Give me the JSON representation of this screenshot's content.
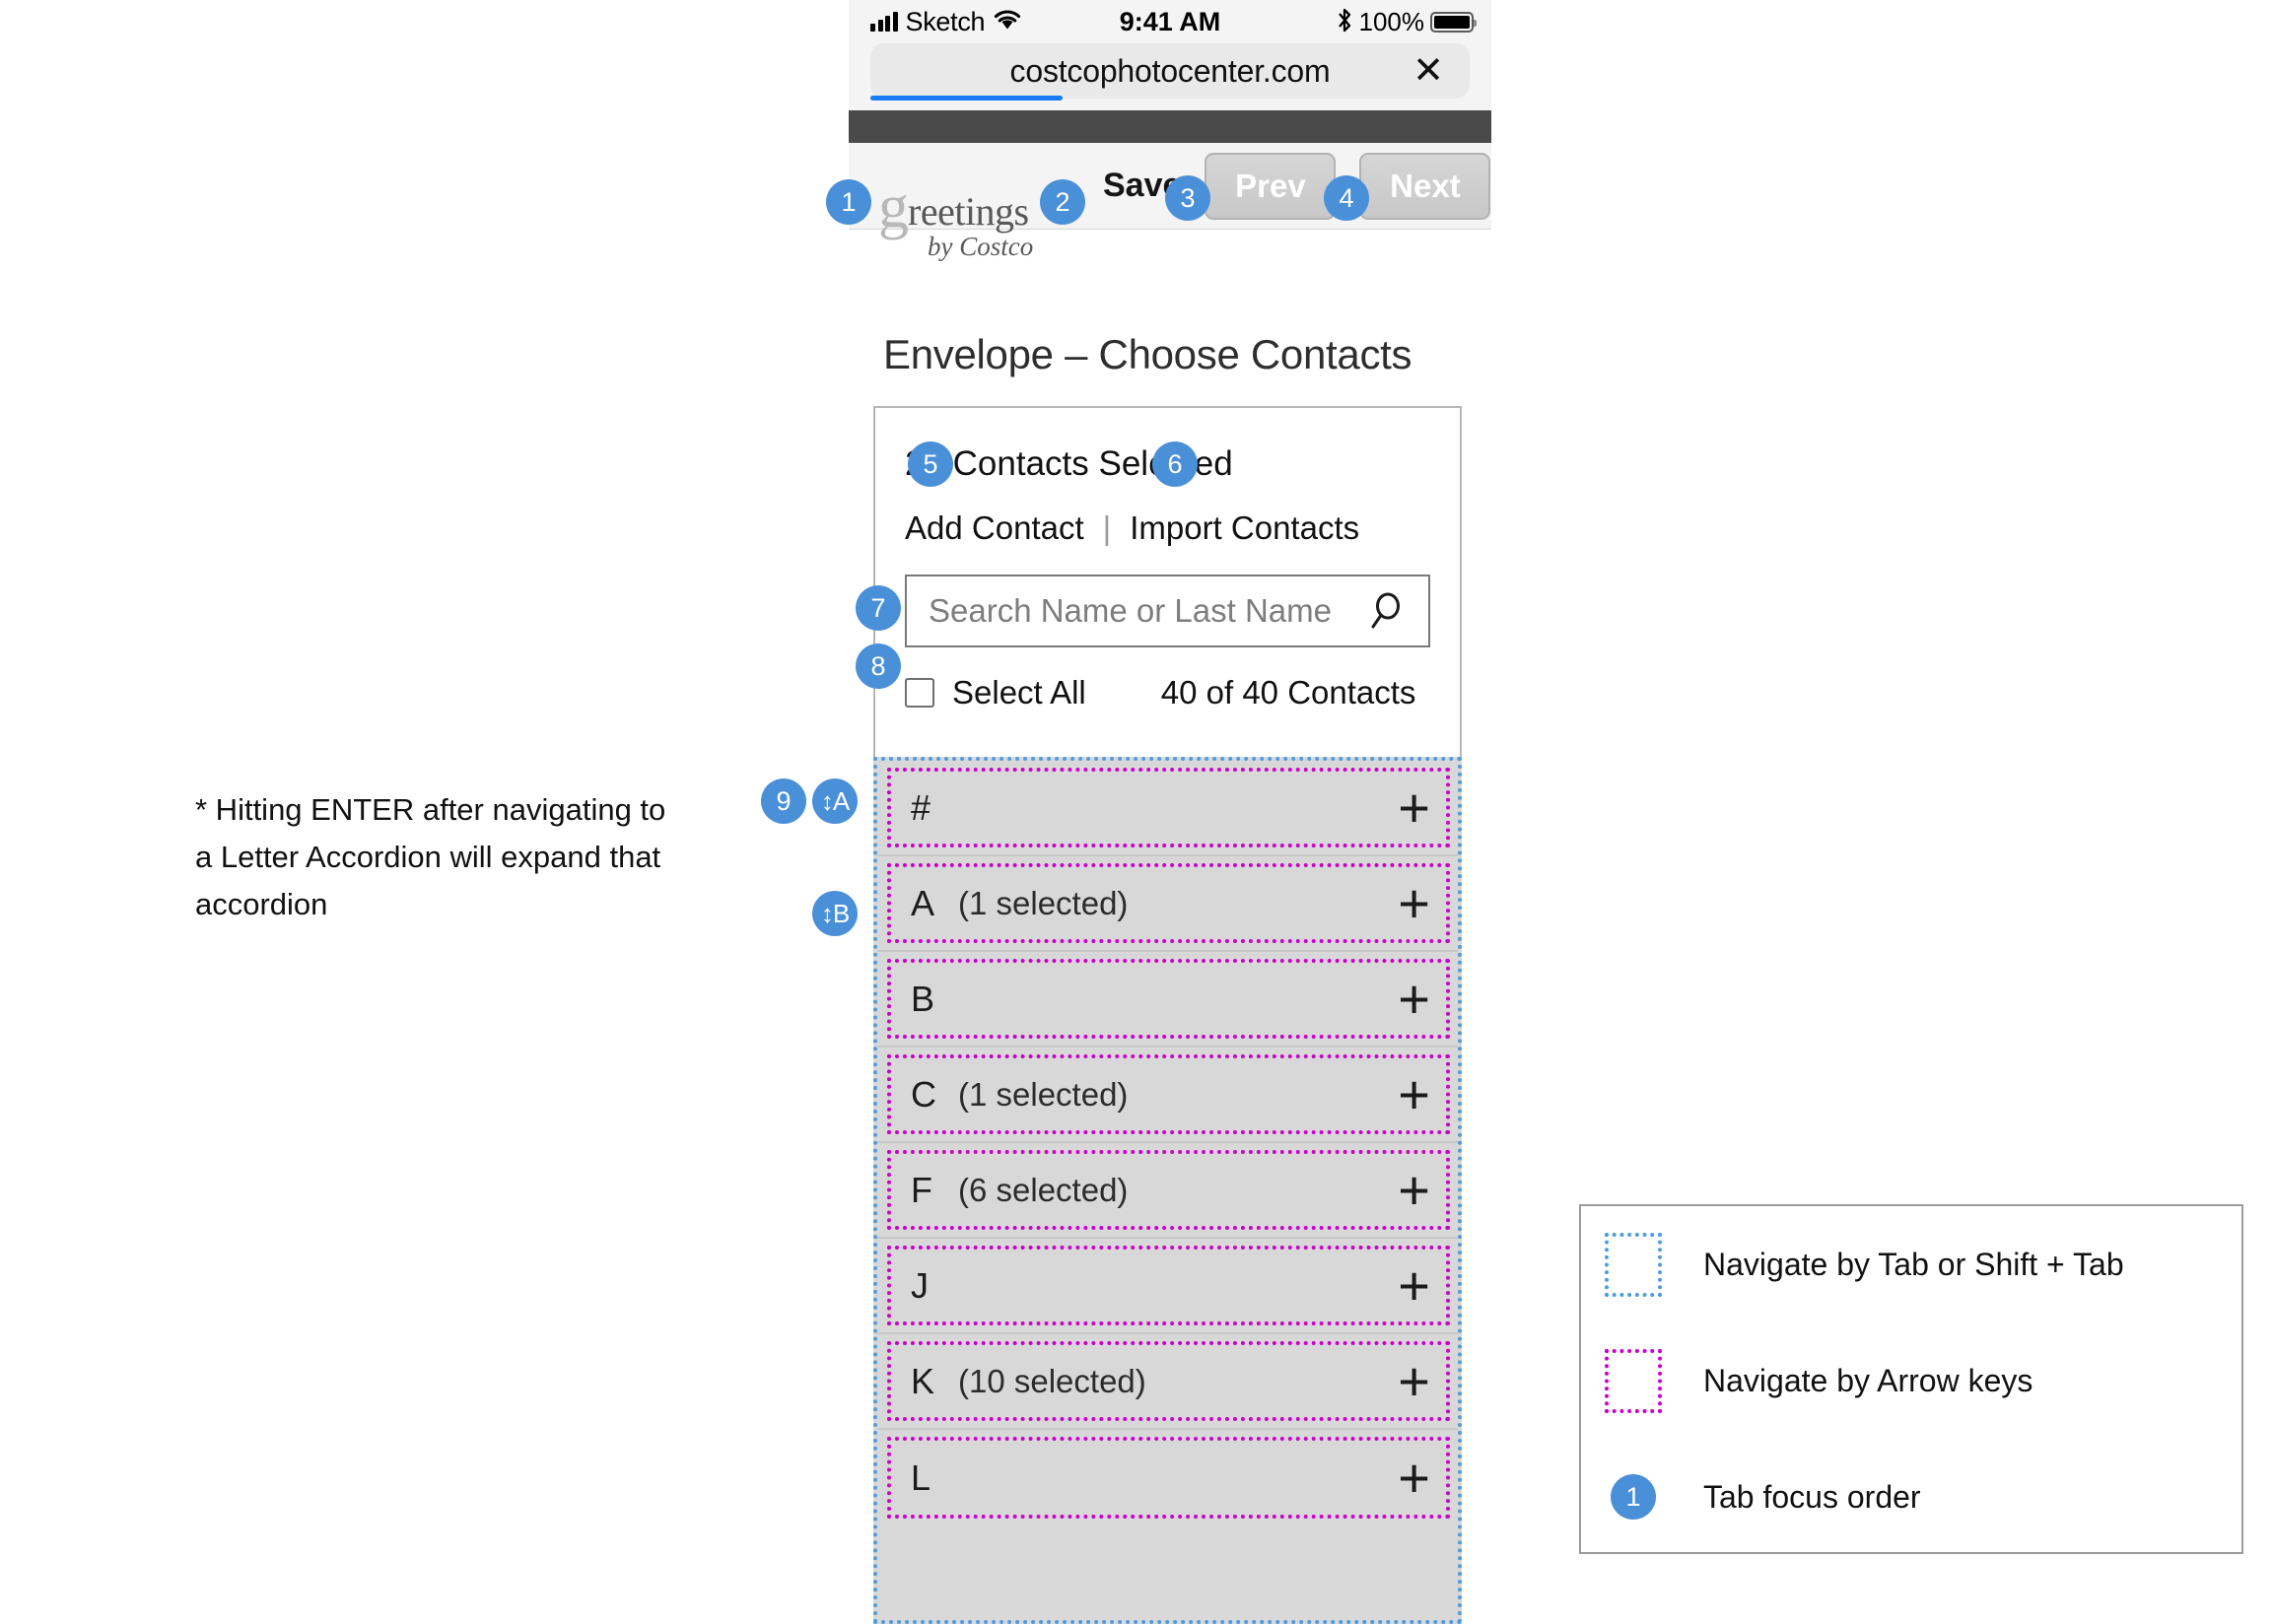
{
  "status_bar": {
    "carrier": "Sketch",
    "time": "9:41 AM",
    "battery_percent": "100%",
    "wifi_icon": "wifi-icon",
    "bluetooth_icon": "bluetooth-icon",
    "signal_icon": "signal-bars-icon",
    "battery_icon": "battery-icon"
  },
  "browser": {
    "url": "costcophotocenter.com",
    "close_icon": "✕"
  },
  "toolbar": {
    "logo_g": "g",
    "logo_rest": "reetings",
    "logo_sub": "by Costco",
    "save_label": "Save",
    "prev_label": "Prev",
    "next_label": "Next"
  },
  "page": {
    "title": "Envelope – Choose Contacts"
  },
  "card": {
    "selected_count": "27 Contacts Selected",
    "add_contact": "Add Contact",
    "separator": "|",
    "import_contacts": "Import Contacts",
    "search_placeholder": "Search Name or Last Name",
    "search_value": "",
    "search_icon": "search-icon",
    "select_all_label": "Select All",
    "contact_count": "40 of 40 Contacts"
  },
  "accordion": {
    "plus_icon": "+",
    "rows": [
      {
        "letter": "#",
        "selected": ""
      },
      {
        "letter": "A",
        "selected": "(1 selected)"
      },
      {
        "letter": "B",
        "selected": ""
      },
      {
        "letter": "C",
        "selected": "(1 selected)"
      },
      {
        "letter": "F",
        "selected": "(6 selected)"
      },
      {
        "letter": "J",
        "selected": ""
      },
      {
        "letter": "K",
        "selected": "(10 selected)"
      },
      {
        "letter": "L",
        "selected": ""
      }
    ]
  },
  "badges": {
    "b1": "1",
    "b2": "2",
    "b3": "3",
    "b4": "4",
    "b5": "5",
    "b6": "6",
    "b7": "7",
    "b8": "8",
    "b9": "9",
    "key_a": "↕A",
    "key_b": "↕B"
  },
  "note": {
    "text": "* Hitting ENTER after navigating to a Letter Accordion will expand that accordion"
  },
  "legend": {
    "tab_label": "Navigate by Tab or Shift + Tab",
    "arrow_label": "Navigate by Arrow keys",
    "focus_badge": "1",
    "focus_label": "Tab focus order"
  },
  "colors": {
    "accent_blue": "#4a90d9",
    "tab_outline": "#4e9ce0",
    "arrow_outline": "#cc00cc",
    "dark_bar": "#4a4a4a",
    "list_bg": "#d8d8d8"
  }
}
